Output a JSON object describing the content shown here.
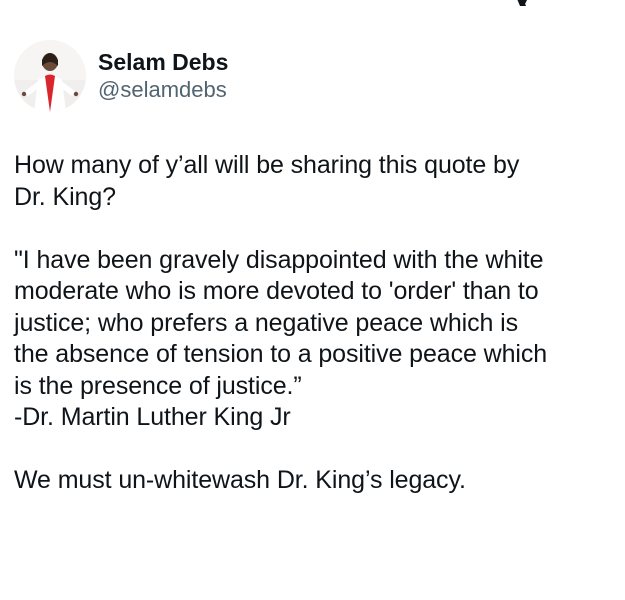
{
  "author": {
    "display_name": "Selam Debs",
    "handle": "@selamdebs"
  },
  "tweet": {
    "intro": [
      "How many of y’all will be sharing this quote by",
      "Dr. King?"
    ],
    "quote": [
      "\"I have been gravely disappointed with the white",
      "moderate who is more devoted to 'order' than to",
      "justice; who prefers a negative peace which is",
      "the absence of tension to a positive peace which",
      "is the presence of justice.”",
      "-Dr. Martin Luther King Jr"
    ],
    "closing": "We must un-whitewash Dr. King’s legacy."
  },
  "icons": {
    "logo": "x-logo-icon",
    "avatar": "avatar-photo"
  }
}
